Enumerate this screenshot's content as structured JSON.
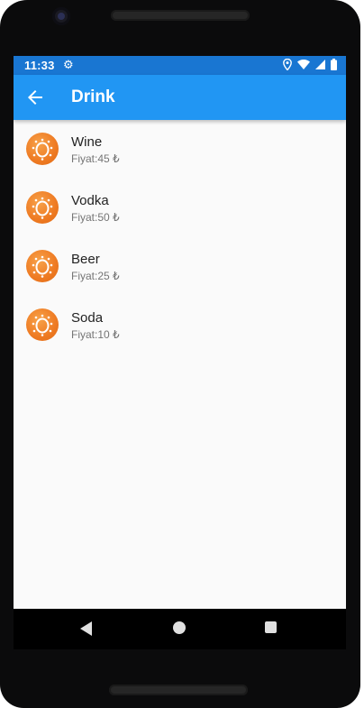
{
  "status_bar": {
    "time": "11:33",
    "icons": [
      "gear-icon",
      "location-icon",
      "wifi-icon",
      "signal-icon",
      "battery-icon"
    ]
  },
  "app_bar": {
    "title": "Drink",
    "back_icon": "arrow-left-icon",
    "color": "#2196f3"
  },
  "drinks": [
    {
      "name": "Wine",
      "price": "Fiyat:45 ₺"
    },
    {
      "name": "Vodka",
      "price": "Fiyat:50 ₺"
    },
    {
      "name": "Beer",
      "price": "Fiyat:25 ₺"
    },
    {
      "name": "Soda",
      "price": "Fiyat:10 ₺"
    }
  ],
  "nav_bar": {
    "icons": [
      "nav-back-icon",
      "nav-home-icon",
      "nav-recents-icon"
    ]
  },
  "colors": {
    "status_bar": "#1976d2",
    "avatar": "#ee7a22"
  }
}
